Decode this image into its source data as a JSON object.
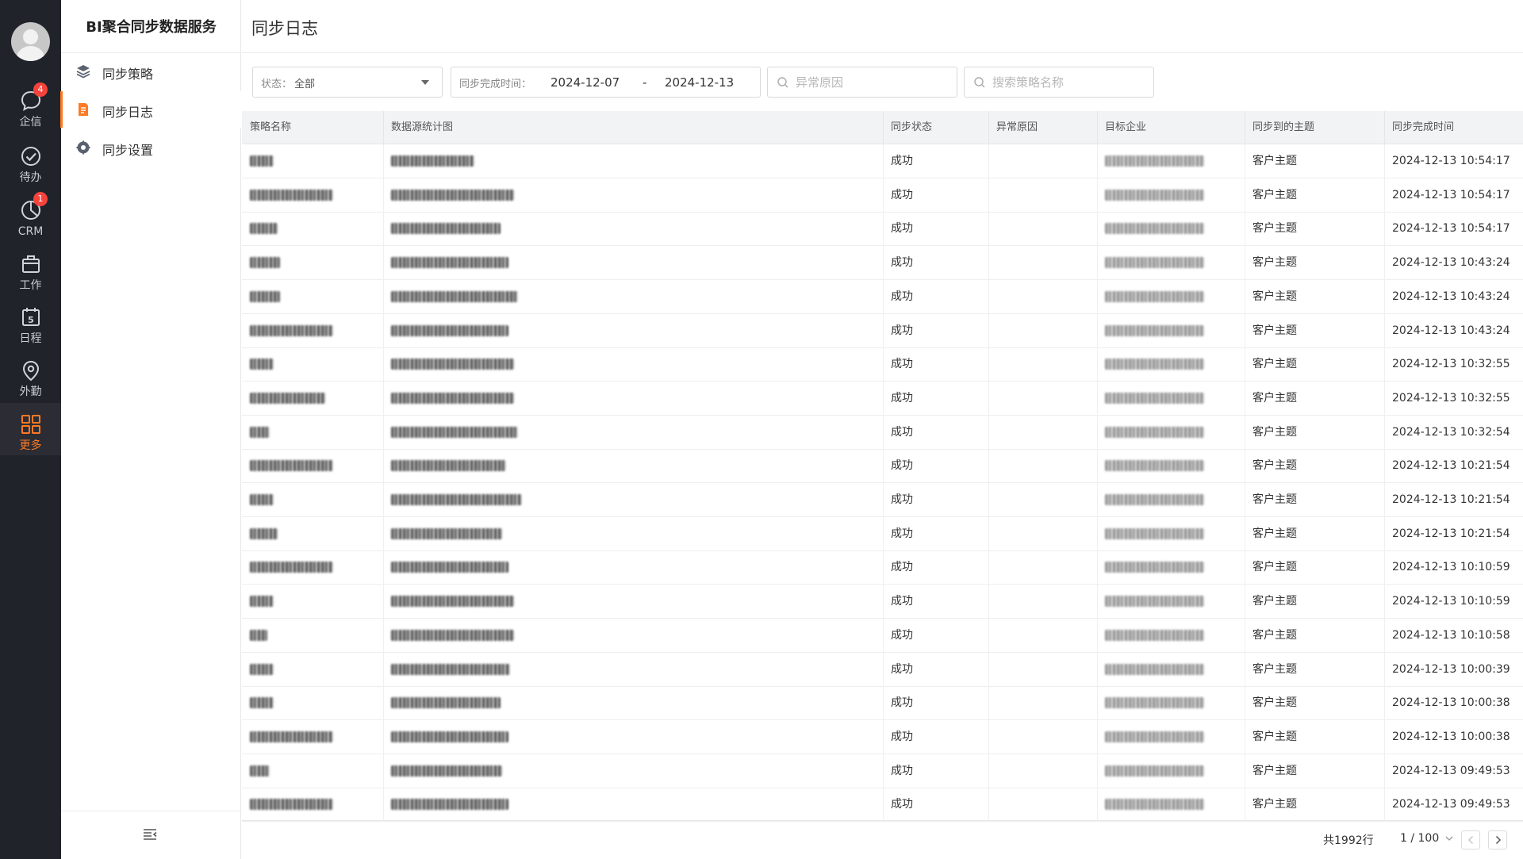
{
  "rail": {
    "items": [
      {
        "label": "企信",
        "badge": "4"
      },
      {
        "label": "待办",
        "badge": ""
      },
      {
        "label": "CRM",
        "badge": "1"
      },
      {
        "label": "工作",
        "badge": ""
      },
      {
        "label": "日程",
        "badge": "",
        "icon_text": "5"
      },
      {
        "label": "外勤",
        "badge": ""
      },
      {
        "label": "更多",
        "badge": ""
      }
    ],
    "accent_color": "#ff7a24"
  },
  "sidebar": {
    "title": "BI聚合同步数据服务",
    "items": [
      {
        "label": "同步策略",
        "icon": "layers-icon"
      },
      {
        "label": "同步日志",
        "icon": "document-icon"
      },
      {
        "label": "同步设置",
        "icon": "gear-icon"
      }
    ]
  },
  "page": {
    "title": "同步日志"
  },
  "filters": {
    "status_label": "状态：",
    "status_value": "全部",
    "date_label": "同步完成时间：",
    "date_start": "2024-12-07",
    "date_sep": "-",
    "date_end": "2024-12-13",
    "reason_placeholder": "异常原因",
    "name_placeholder": "搜索策略名称"
  },
  "table": {
    "columns": [
      "策略名称",
      "数据源统计图",
      "同步状态",
      "异常原因",
      "目标企业",
      "同步到的主题",
      "同步完成时间"
    ],
    "rows": [
      {
        "status": "成功",
        "reason": "",
        "topic": "客户主题",
        "time": "2024-12-13 10:54:17"
      },
      {
        "status": "成功",
        "reason": "",
        "topic": "客户主题",
        "time": "2024-12-13 10:54:17"
      },
      {
        "status": "成功",
        "reason": "",
        "topic": "客户主题",
        "time": "2024-12-13 10:54:17"
      },
      {
        "status": "成功",
        "reason": "",
        "topic": "客户主题",
        "time": "2024-12-13 10:43:24"
      },
      {
        "status": "成功",
        "reason": "",
        "topic": "客户主题",
        "time": "2024-12-13 10:43:24"
      },
      {
        "status": "成功",
        "reason": "",
        "topic": "客户主题",
        "time": "2024-12-13 10:43:24"
      },
      {
        "status": "成功",
        "reason": "",
        "topic": "客户主题",
        "time": "2024-12-13 10:32:55"
      },
      {
        "status": "成功",
        "reason": "",
        "topic": "客户主题",
        "time": "2024-12-13 10:32:55"
      },
      {
        "status": "成功",
        "reason": "",
        "topic": "客户主题",
        "time": "2024-12-13 10:32:54"
      },
      {
        "status": "成功",
        "reason": "",
        "topic": "客户主题",
        "time": "2024-12-13 10:21:54"
      },
      {
        "status": "成功",
        "reason": "",
        "topic": "客户主题",
        "time": "2024-12-13 10:21:54"
      },
      {
        "status": "成功",
        "reason": "",
        "topic": "客户主题",
        "time": "2024-12-13 10:21:54"
      },
      {
        "status": "成功",
        "reason": "",
        "topic": "客户主题",
        "time": "2024-12-13 10:10:59"
      },
      {
        "status": "成功",
        "reason": "",
        "topic": "客户主题",
        "time": "2024-12-13 10:10:59"
      },
      {
        "status": "成功",
        "reason": "",
        "topic": "客户主题",
        "time": "2024-12-13 10:10:58"
      },
      {
        "status": "成功",
        "reason": "",
        "topic": "客户主题",
        "time": "2024-12-13 10:00:39"
      },
      {
        "status": "成功",
        "reason": "",
        "topic": "客户主题",
        "time": "2024-12-13 10:00:38"
      },
      {
        "status": "成功",
        "reason": "",
        "topic": "客户主题",
        "time": "2024-12-13 10:00:38"
      },
      {
        "status": "成功",
        "reason": "",
        "topic": "客户主题",
        "time": "2024-12-13 09:49:53"
      },
      {
        "status": "成功",
        "reason": "",
        "topic": "客户主题",
        "time": "2024-12-13 09:49:53"
      }
    ]
  },
  "pager": {
    "total": "共1992行",
    "page": "1 / 100"
  }
}
